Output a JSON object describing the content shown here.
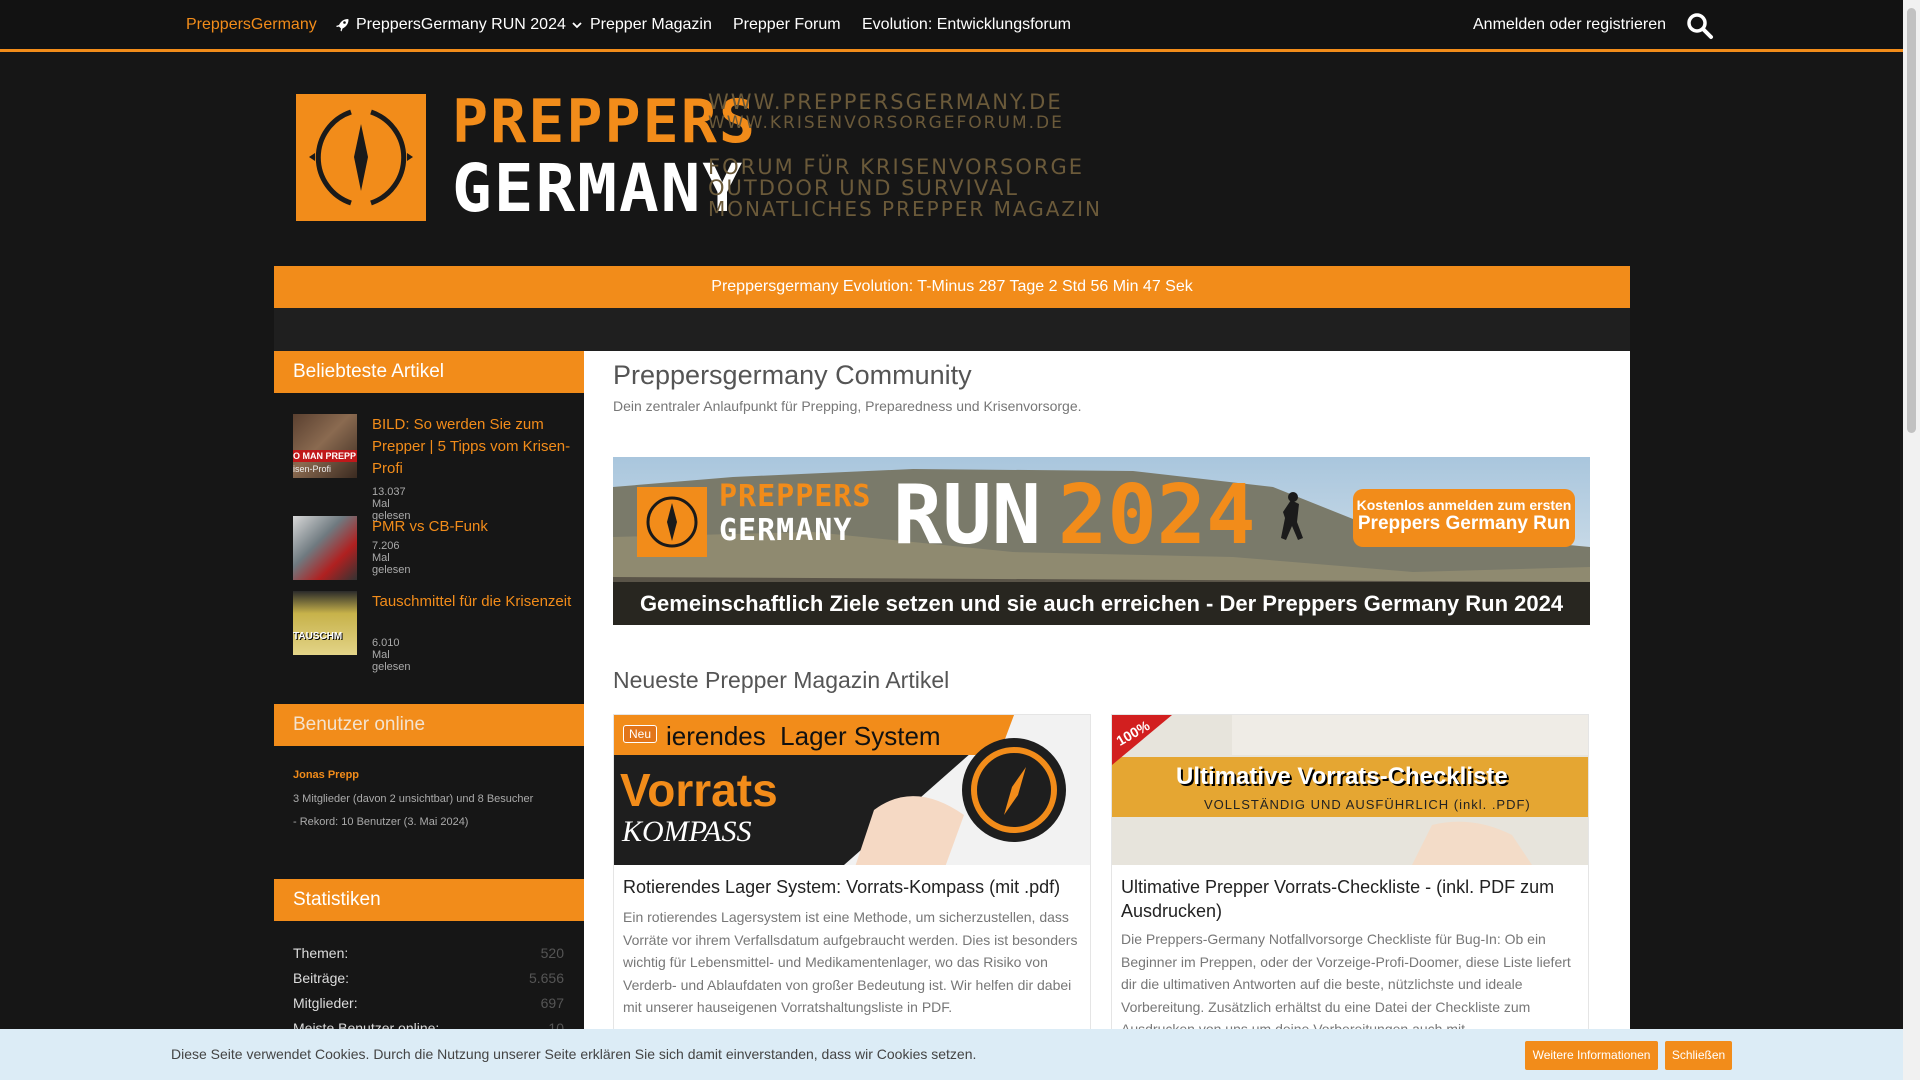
{
  "nav": {
    "items": [
      {
        "label": "PreppersGermany"
      },
      {
        "label": "PreppersGermany RUN 2024"
      },
      {
        "label": "Prepper Magazin"
      },
      {
        "label": "Prepper Forum"
      },
      {
        "label": "Evolution: Entwicklungsforum"
      }
    ],
    "login": "Anmelden oder registrieren",
    "search_icon": "search-icon",
    "accent": "#f28c1a"
  },
  "logo": {
    "word1": "PREPPERS",
    "word2": "GERMANY",
    "url1": "WWW.PREPPERSGERMANY.DE",
    "url2": "WWW.KRISENVORSORGEFORUM.DE",
    "tag1": "FORUM FÜR KRISENVORSORGE",
    "tag2": "OUTDOOR UND SURVIVAL",
    "tag3": "MONATLICHES PREPPER MAGAZIN"
  },
  "countdown": "Preppersgermany Evolution: T-Minus 287 Tage 2 Std 56 Min 47 Sek",
  "sidebar": {
    "popular": {
      "title": "Beliebteste Artikel",
      "articles": [
        {
          "title": "BILD: So werden Sie zum Prepper | 5 Tipps vom Krisen-Profi",
          "views": "13.037 Mal gelesen",
          "thumb_text": "O MAN PREPP",
          "thumb_sub": "isen-Profi"
        },
        {
          "title": "PMR vs CB-Funk",
          "views": "7.206 Mal gelesen"
        },
        {
          "title": "Tauschmittel für die Krisenzeit",
          "views": "6.010 Mal gelesen",
          "thumb_text": "TAUSCHM"
        }
      ]
    },
    "online": {
      "title": "Benutzer online",
      "user": "Jonas Prepp",
      "line1": "3 Mitglieder (davon 2 unsichtbar) und 8 Besucher",
      "line2": "- Rekord: 10 Benutzer (3. Mai 2024)"
    },
    "stats": {
      "title": "Statistiken",
      "rows": [
        {
          "label": "Themen:",
          "value": "520"
        },
        {
          "label": "Beiträge:",
          "value": "5.656"
        },
        {
          "label": "Mitglieder:",
          "value": "697"
        },
        {
          "label": "Meiste Benutzer online:",
          "value": "10"
        }
      ]
    }
  },
  "main": {
    "title": "Preppersgermany Community",
    "subtitle": "Dein zentraler Anlaufpunkt für Prepping, Preparedness und Krisenvorsorge.",
    "banner": {
      "logo1": "PREPPERS",
      "logo2": "GERMANY",
      "run": "RUN",
      "year": "2024",
      "btn_line1": "Kostenlos anmelden zum ersten",
      "btn_line2": "Preppers Germany Run",
      "caption": "Gemeinschaftlich Ziele setzen und sie auch erreichen - Der Preppers Germany Run 2024"
    },
    "section_title": "Neueste Prepper Magazin Artikel",
    "cards": [
      {
        "badge": "Neu",
        "img_title": "ierendes  Lager System",
        "img_word1": "Vorrats",
        "img_word2": "KOMPASS",
        "title": "Rotierendes Lager System: Vorrats-Kompass (mit .pdf)",
        "text": "Ein rotierendes Lagersystem ist eine Methode, um sicherzustellen, dass Vorräte vor ihrem Verfallsdatum aufgebraucht werden. Dies ist besonders wichtig für Lebensmittel- und Medikamentenlager, wo das Risiko von Verderb- und Ablaufdaten von großer Bedeutung ist. Wir helfen dir dabei mit unserer hauseigenen Vorratshaltungsliste in PDF."
      },
      {
        "img_stamp": "100%",
        "img_title": "Ultimative Vorrats-Checkliste",
        "img_sub": "VOLLSTÄNDIG UND AUSFÜHRLICH (inkl. .PDF)",
        "title": "Ultimative Prepper Vorrats-Checkliste - (inkl. PDF zum Ausdrucken)",
        "text": "Die Preppers-Germany Notfallvorsorge Checkliste für Bug-In: Ob ein Beginner im Preppen, oder der Vorzeige-Profi-Doomer, diese Liste liefert dir die ultimativen Antworten auf die beste, nützlichste und ideale Vorbereitung. Zusätzlich erhältst du eine Datei der Checkliste zum Ausdrucken von uns um deine Vorbereitungen auch mit"
      }
    ]
  },
  "cookie": {
    "text": "Diese Seite verwendet Cookies. Durch die Nutzung unserer Seite erklären Sie sich damit einverstanden, dass wir Cookies setzen.",
    "more": "Weitere Informationen",
    "close": "Schließen"
  }
}
